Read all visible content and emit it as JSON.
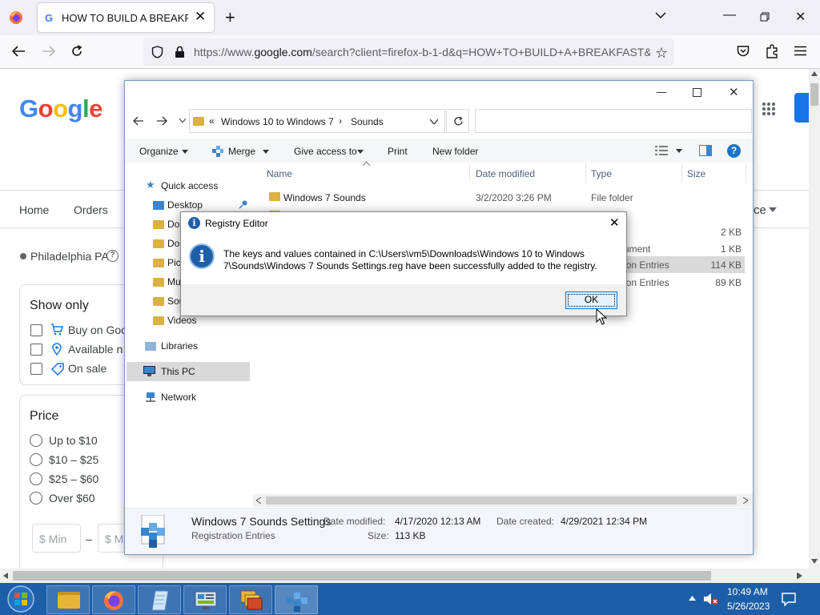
{
  "browser": {
    "tab_title": "HOW TO BUILD A BREAKFAST",
    "url_prefix": "https://www.",
    "url_host": "google.com",
    "url_rest": "/search?client=firefox-b-1-d&q=HOW+TO+BUILD+A+BREAKFAST&"
  },
  "google": {
    "logo": "Google",
    "nav": [
      "Home",
      "Orders"
    ],
    "nav_partial_right": "ce",
    "location": "Philadelphia PA",
    "show_only": {
      "title": "Show only",
      "items": [
        "Buy on Goo",
        "Available n",
        "On sale"
      ]
    },
    "price": {
      "title": "Price",
      "options": [
        "Up to $10",
        "$10 – $25",
        "$25 – $60",
        "Over $60"
      ],
      "min_placeholder": "$ Min",
      "dash": "–",
      "max_placeholder": "$ M"
    }
  },
  "explorer": {
    "breadcrumb_prefix": "«",
    "breadcrumb": [
      "Windows 10 to Windows 7",
      "Sounds"
    ],
    "commands": {
      "organize": "Organize",
      "merge": "Merge",
      "give_access": "Give access to",
      "print": "Print",
      "new_folder": "New folder"
    },
    "columns": {
      "name": "Name",
      "date": "Date modified",
      "type": "Type",
      "size": "Size"
    },
    "nav_pane": {
      "quick_access": "Quick access",
      "items": [
        "Desktop",
        "Do",
        "Do",
        "Pic",
        "Mu",
        "Sou",
        "Videos"
      ],
      "libraries": "Libraries",
      "this_pc": "This PC",
      "network": "Network"
    },
    "files": [
      {
        "name": "Windows 7 Sounds",
        "date": "3/2/2020 3:26 PM",
        "type": "File folder",
        "size": ""
      },
      {
        "name": "",
        "date": "",
        "type": "",
        "size": "2 KB"
      },
      {
        "name": "",
        "date": "",
        "type": "ument",
        "size": "1 KB"
      },
      {
        "name": "",
        "date": "",
        "type": "ion Entries",
        "size": "114 KB"
      },
      {
        "name": "",
        "date": "",
        "type": "ion Entries",
        "size": "89 KB"
      }
    ],
    "details": {
      "name": "Windows 7 Sounds Settings",
      "kind": "Registration Entries",
      "date_modified_label": "Date modified:",
      "date_modified": "4/17/2020 12:13 AM",
      "size_label": "Size:",
      "size": "113 KB",
      "date_created_label": "Date created:",
      "date_created": "4/29/2021 12:34 PM"
    }
  },
  "dialog": {
    "title": "Registry Editor",
    "message": "The keys and values contained in C:\\Users\\vm5\\Downloads\\Windows 10 to Windows 7\\Sounds\\Windows 7 Sounds Settings.reg have been successfully added to the registry.",
    "ok": "OK"
  },
  "taskbar": {
    "time": "10:49 AM",
    "date": "5/26/2023"
  },
  "colors": {
    "firefox_tabstrip": "#f0f0f4",
    "taskbar": "#1c5ea8",
    "explorer_selection": "#cce8ff",
    "dialog_bg": "#f0f0f0",
    "accent": "#0078d7"
  }
}
